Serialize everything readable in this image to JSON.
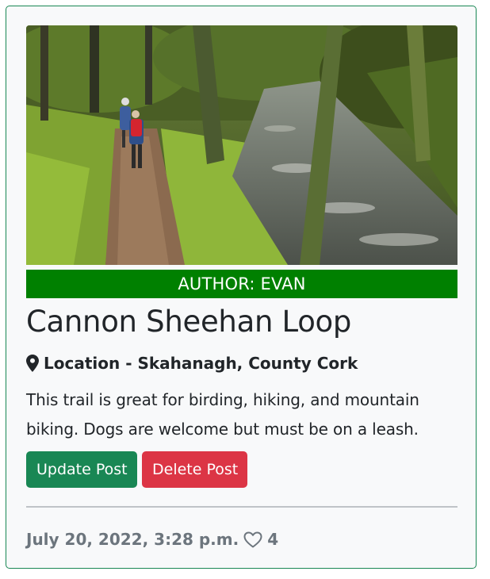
{
  "post": {
    "author_label": "AUTHOR: EVAN",
    "title": "Cannon Sheehan Loop",
    "location": "Location - Skahanagh, County Cork",
    "description": "This trail is great for birding, hiking, and mountain biking. Dogs are welcome but must be on a leash.",
    "date": "July 20, 2022, 3:28 p.m.",
    "likes": "4",
    "image_icon": "trail-photo"
  },
  "actions": {
    "update_label": "Update Post",
    "delete_label": "Delete Post"
  },
  "icons": {
    "location": "map-marker-icon",
    "like": "heart-outline-icon"
  },
  "colors": {
    "card_border": "#198754",
    "author_bar": "#008000",
    "update_button": "#198754",
    "delete_button": "#dc3545",
    "muted_text": "#6c757d"
  }
}
